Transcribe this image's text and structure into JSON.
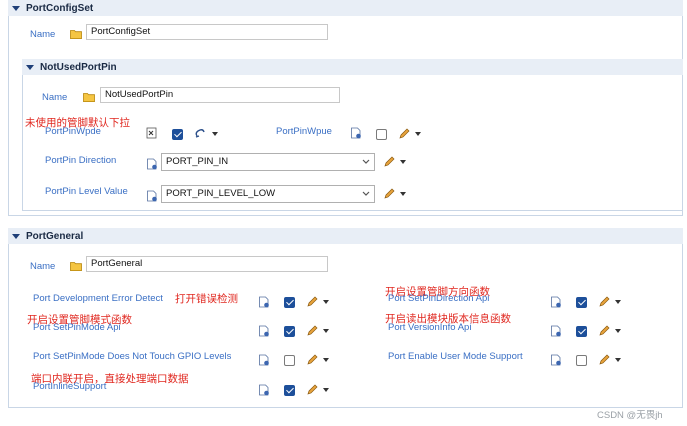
{
  "port_config_set": {
    "header": "PortConfigSet",
    "name_label": "Name",
    "name_value": "PortConfigSet"
  },
  "not_used_port_pin": {
    "header": "NotUsedPortPin",
    "name_label": "Name",
    "name_value": "NotUsedPortPin",
    "annotation": "未使用的管脚默认下拉",
    "wpde_label": "PortPinWpde",
    "wpde_checked": true,
    "wpue_label": "PortPinWpue",
    "wpue_checked": false,
    "direction_label": "PortPin Direction",
    "direction_value": "PORT_PIN_IN",
    "level_label": "PortPin Level Value",
    "level_value": "PORT_PIN_LEVEL_LOW"
  },
  "port_general": {
    "header": "PortGeneral",
    "name_label": "Name",
    "name_value": "PortGeneral",
    "items": [
      {
        "label": "Port Development Error Detect",
        "checked": true,
        "note": "打开错误检测"
      },
      {
        "label": "Port SetPinDirection Api",
        "checked": true,
        "note": "开启设置管脚方向函数"
      },
      {
        "label": "Port SetPinMode Api",
        "checked": true,
        "note": "开启设置管脚模式函数"
      },
      {
        "label": "Port VersionInfo Api",
        "checked": true,
        "note": "开启读出模块版本信息函数"
      },
      {
        "label": "Port SetPinMode Does Not Touch GPIO Levels",
        "checked": false,
        "note": ""
      },
      {
        "label": "Port Enable User Mode Support",
        "checked": false,
        "note": ""
      },
      {
        "label": "PortInlineSupport",
        "checked": true,
        "note": "端口内联开启，直接处理端口数据"
      }
    ]
  },
  "watermark": "CSDN @无畏jh",
  "colors": {
    "label_blue": "#3a6fc4",
    "annotation_red": "#e0271f",
    "checkbox_on": "#1d4f9a",
    "header_bg": "#e8eef6"
  },
  "icons": [
    "folder-icon",
    "property-icon",
    "edit-pencil-icon",
    "dropdown-arrow-icon",
    "link-icon"
  ]
}
